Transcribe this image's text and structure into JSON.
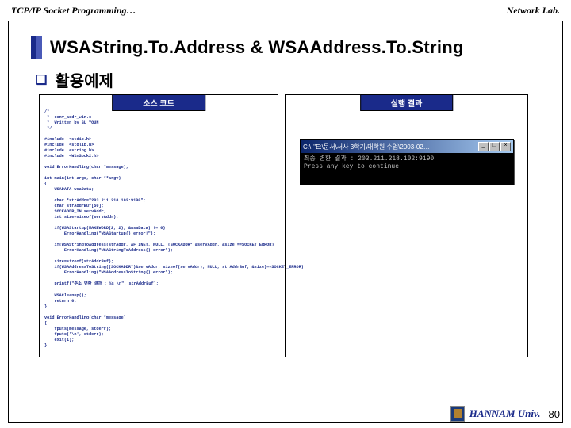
{
  "header": {
    "left": "TCP/IP Socket Programming…",
    "right": "Network Lab."
  },
  "title": "WSAString.To.Address & WSAAddress.To.String",
  "subtitle": "활용예제",
  "panels": {
    "left_label": "소스 코드",
    "right_label": "실행 결과"
  },
  "code_text": "/*\n *  conv_addr_win.c\n *  Written by SL_YOUN\n */\n\n#include  <stdio.h>\n#include  <stdlib.h>\n#include  <string.h>\n#include  <WinSock2.h>\n\nvoid ErrorHandling(char *message);\n\nint main(int argc, char **argv)\n{\n    WSADATA wsaData;\n\n    char *strAddr=\"203.211.218.102:9190\";\n    char strAddrBuf[50];\n    SOCKADDR_IN servAddr;\n    int size=sizeof(servAddr);\n\n    if(WSAStartup(MAKEWORD(2, 2), &wsaData) != 0)\n        ErrorHandling(\"WSAStartup() error!\");\n\n    if(WSAStringToAddress(strAddr, AF_INET, NULL, (SOCKADDR*)&servAddr, &size)==SOCKET_ERROR)\n        ErrorHandling(\"WSAStringToAddress() error\");\n\n    size=sizeof(strAddrBuf);\n    if(WSAAddressToString((SOCKADDR*)&servAddr, sizeof(servAddr), NULL, strAddrBuf, &size)==SOCKET_ERROR)\n        ErrorHandling(\"WSAAddressToString() error\");\n\n    printf(\"주소 변환 결과 : %s \\n\", strAddrBuf);\n\n    WSACleanup();\n    return 0;\n}\n\nvoid ErrorHandling(char *message)\n{\n    fputs(message, stderr);\n    fputc('\\n', stderr);\n    exit(1);\n}",
  "console": {
    "title": "\"E:\\문서\\서사 3학기\\대학원 수업\\2003-02…",
    "line1": "최종 변환 결과 : 203.211.218.102:9190",
    "line2": "Press any key to continue"
  },
  "win_buttons": {
    "min": "_",
    "max": "□",
    "close": "×"
  },
  "footer": {
    "university": "HANNAM Univ.",
    "page": "80"
  }
}
